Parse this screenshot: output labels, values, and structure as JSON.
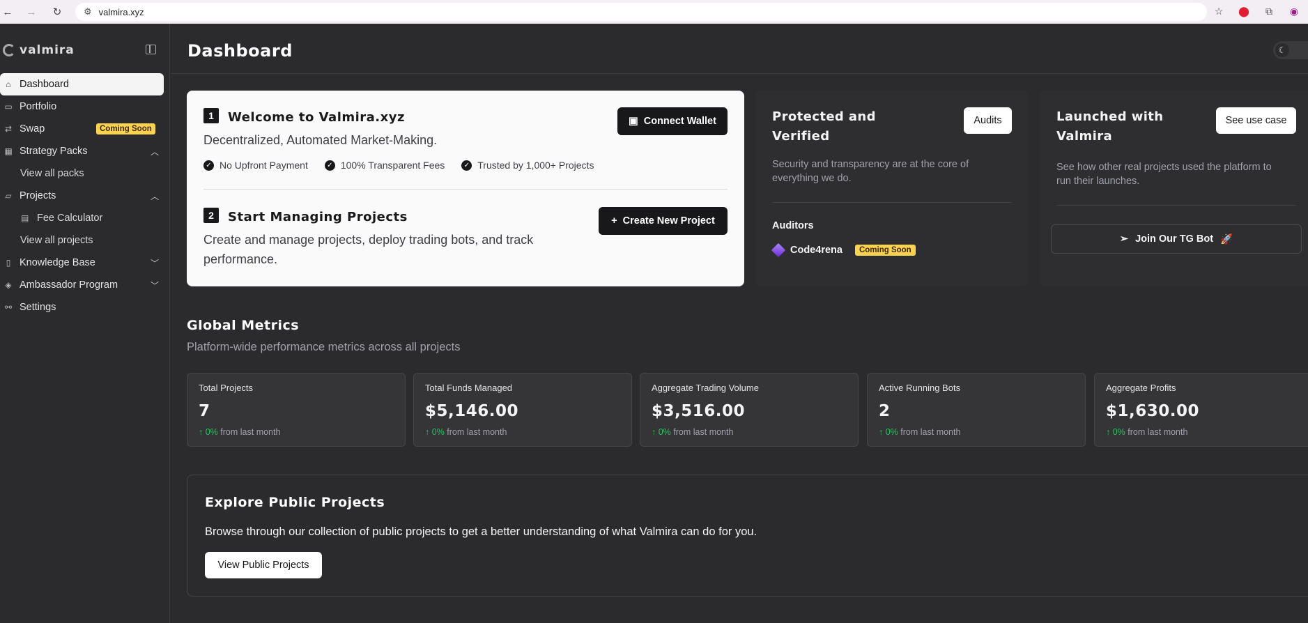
{
  "browser": {
    "url": "valmira.xyz"
  },
  "app": {
    "name": "valmira"
  },
  "sidebar": {
    "items": [
      {
        "label": "Dashboard"
      },
      {
        "label": "Portfolio"
      },
      {
        "label": "Swap",
        "badge": "Coming Soon"
      },
      {
        "label": "Strategy Packs"
      },
      {
        "label": "View all packs"
      },
      {
        "label": "Projects"
      },
      {
        "label": "Fee Calculator"
      },
      {
        "label": "View all projects"
      },
      {
        "label": "Knowledge Base"
      },
      {
        "label": "Ambassador Program"
      },
      {
        "label": "Settings"
      }
    ]
  },
  "header": {
    "title": "Dashboard"
  },
  "welcome": {
    "step1_num": "1",
    "step1_title": "Welcome to Valmira.xyz",
    "step1_desc": "Decentralized, Automated Market-Making.",
    "connect_label": "Connect Wallet",
    "features": [
      "No Upfront Payment",
      "100% Transparent Fees",
      "Trusted by 1,000+ Projects"
    ],
    "step2_num": "2",
    "step2_title": "Start Managing Projects",
    "step2_desc_line1": "Create and manage projects, deploy trading bots, and track",
    "step2_desc_line2": "performance.",
    "create_label": "Create New Project"
  },
  "protected": {
    "title_line1": "Protected and",
    "title_line2": "Verified",
    "audits_label": "Audits",
    "desc_line1": "Security and transparency are at the core of",
    "desc_line2": "everything we do.",
    "auditors_label": "Auditors",
    "auditor_name": "Code4rena",
    "auditor_badge": "Coming Soon"
  },
  "launched": {
    "title_line1": "Launched with",
    "title_line2": "Valmira",
    "use_case_label": "See use case",
    "desc_line1": "See how other real projects used the platform to",
    "desc_line2": "run their launches.",
    "tg_label": "Join Our TG Bot",
    "tg_emoji": "🚀"
  },
  "metrics": {
    "title": "Global Metrics",
    "subtitle": "Platform-wide performance metrics across all projects",
    "cards": [
      {
        "label": "Total Projects",
        "value": "7",
        "change": "0%",
        "suffix": "from last month"
      },
      {
        "label": "Total Funds Managed",
        "value": "$5,146.00",
        "change": "0%",
        "suffix": "from last month"
      },
      {
        "label": "Aggregate Trading Volume",
        "value": "$3,516.00",
        "change": "0%",
        "suffix": "from last month"
      },
      {
        "label": "Active Running Bots",
        "value": "2",
        "change": "0%",
        "suffix": "from last month"
      },
      {
        "label": "Aggregate Profits",
        "value": "$1,630.00",
        "change": "0%",
        "suffix": "from last month"
      }
    ]
  },
  "explore": {
    "title": "Explore Public Projects",
    "desc": "Browse through our collection of public projects to get a better understanding of what Valmira can do for you.",
    "button_label": "View Public Projects"
  },
  "colors": {
    "accent_badge": "#fcd34d",
    "positive": "#22c55e",
    "background": "#2b2b2e"
  }
}
